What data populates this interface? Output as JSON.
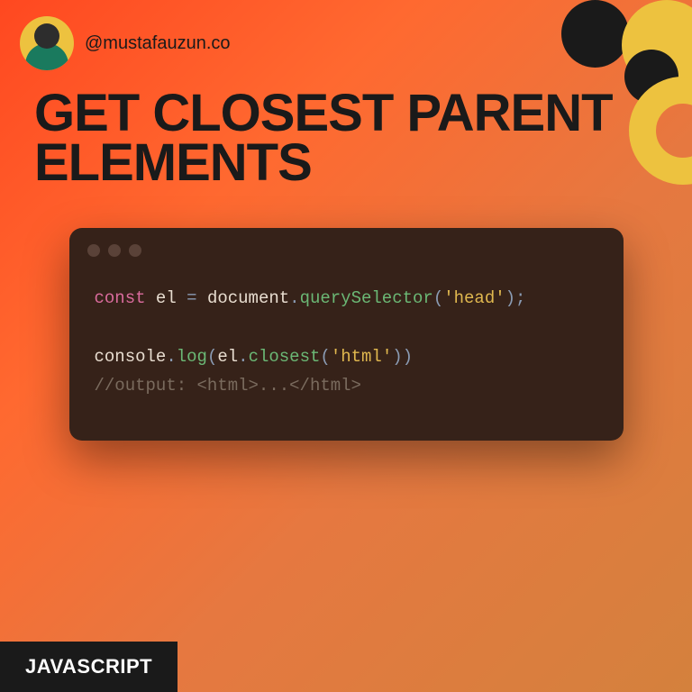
{
  "handle": "@mustafauzun.co",
  "title": "GET CLOSEST PARENT\nELEMENTS",
  "code": {
    "line1": {
      "kw": "const",
      "var": "el",
      "op": "=",
      "obj": "document",
      "method": "querySelector",
      "arg": "'head'"
    },
    "line2": {
      "obj": "console",
      "method1": "log",
      "var": "el",
      "method2": "closest",
      "arg": "'html'"
    },
    "line3": {
      "comment": "//output: <html>...</html>"
    }
  },
  "badge": "JAVASCRIPT"
}
